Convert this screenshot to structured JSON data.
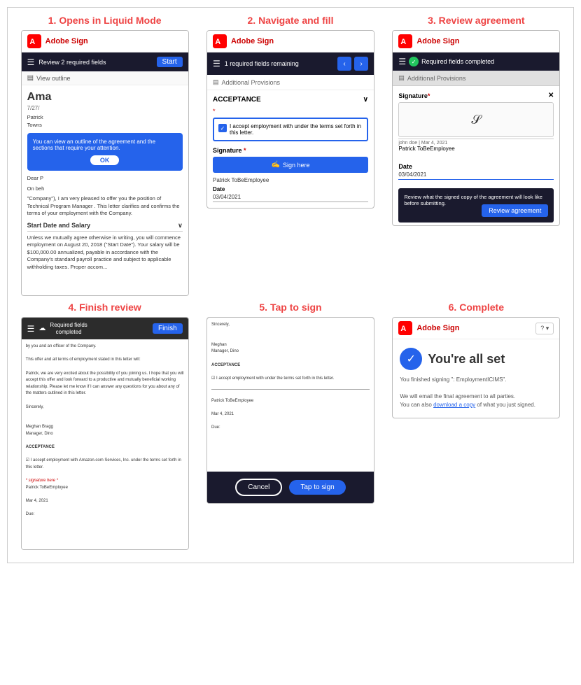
{
  "steps": [
    {
      "number": "1.",
      "title": "Opens in Liquid Mode",
      "color": "#cc0000"
    },
    {
      "number": "2.",
      "title": "Navigate and fill",
      "color": "#cc0000"
    },
    {
      "number": "3.",
      "title": "Review agreement",
      "color": "#cc0000"
    },
    {
      "number": "4.",
      "title": "Finish review",
      "color": "#cc0000"
    },
    {
      "number": "5.",
      "title": "Tap to sign",
      "color": "#cc0000"
    },
    {
      "number": "6.",
      "title": "Complete",
      "color": "#cc0000"
    }
  ],
  "step1": {
    "adobe_sign_label": "Adobe Sign",
    "nav_text": "Review 2 required fields",
    "start_btn": "Start",
    "view_outline": "View outline",
    "doc_title": "Ama",
    "doc_date": "7/27/",
    "doc_author": "Patrick",
    "doc_author2": "Towns",
    "tooltip_text": "You can view an outline of the agreement and the sections that require your attention.",
    "tooltip_ok": "OK",
    "doc_para1": "Dear P",
    "doc_para2": "On beh",
    "doc_para3": "\"Company\"), I am very pleased to offer you the position of Technical Program Manager . This letter clarifies and confirms the terms of your employment with the Company.",
    "section_start": "Start Date and Salary",
    "section_para": "Unless we mutually agree otherwise in writing, you will commence employment on August 20, 2018 (\"Start Date\"). Your salary will be $100,000.00 annualized, payable in accordance with the Company's standard payroll practice and subject to applicable withholding taxes. Proper accom..."
  },
  "step2": {
    "adobe_sign_label": "Adobe Sign",
    "nav_text": "1 required fields remaining",
    "doc_section": "Additional Provisions",
    "acceptance_title": "ACCEPTANCE",
    "asterisk": "*",
    "checkbox_text": "I accept employment with        under the terms set forth in this letter.",
    "signature_label": "Signature",
    "sign_here_btn": "Sign here",
    "signer_name": "Patrick ToBeEmployee",
    "date_label": "Date",
    "date_value": "03/04/2021"
  },
  "step3": {
    "adobe_sign_label": "Adobe Sign",
    "fields_completed": "Required fields completed",
    "doc_section": "Additional Provisions",
    "signature_label": "Signature",
    "sig_meta": "john doe | Mar 4, 2021",
    "signer_name": "Patrick ToBeEmployee",
    "date_label": "Date",
    "date_value": "03/04/2021",
    "review_tooltip_text": "Review what the signed copy of the agreement will look like before submitting.",
    "review_btn": "Review agreement"
  },
  "step4": {
    "top_bar_text1": "Required fields",
    "top_bar_text2": "completed",
    "finish_btn": "Finish",
    "doc_lines": [
      "by you and an officer of the Company.",
      "",
      "This offer and all terms of employment stated in this letter will :",
      "",
      "Patrick, we are very excited about the possibility of you joining us. I hope that you will accept this offer and look forward to",
      "a productive and mutually beneficial working relationship. Please let me know if I can answer any questions for you about",
      "any of the matters outlined in this letter.",
      "",
      "Sincerely,",
      "",
      "",
      "Meghan Bragg",
      "Manager, Dino",
      "",
      "ACCEPTANCE",
      "",
      "[ ] I accept employment with Amazon.com Services, Inc. under the terms set forth in this letter.",
      "",
      "* signature here *",
      "Patrick ToBeEmployee",
      "",
      "Mar 4, 2021",
      "",
      "Due:"
    ]
  },
  "step5": {
    "cancel_btn": "Cancel",
    "tap_to_sign_btn": "Tap to sign",
    "doc_text_sincerely": "Sincerely,",
    "doc_text_meghan": "Meghan",
    "doc_text_manager": "Manager, Dino",
    "acceptance_label": "ACCEPTANCE",
    "checkbox_text": "I accept employment with        under the terms set forth in this letter.",
    "sig_line": "Patrick ToBeEmployee",
    "date_line": "Mar 4, 2021",
    "date_due": "Due:"
  },
  "step6": {
    "adobe_sign_label": "Adobe Sign",
    "question_btn": "? ▾",
    "all_set_title": "You're all set",
    "desc_line1": "You finished signing \":",
    "doc_name": "EmploymentICIMS\".",
    "desc_line2": "We will email the final agreement to all parties.",
    "desc_line3": "You can also",
    "download_link": "download a copy",
    "desc_line4": "of what you just signed."
  }
}
